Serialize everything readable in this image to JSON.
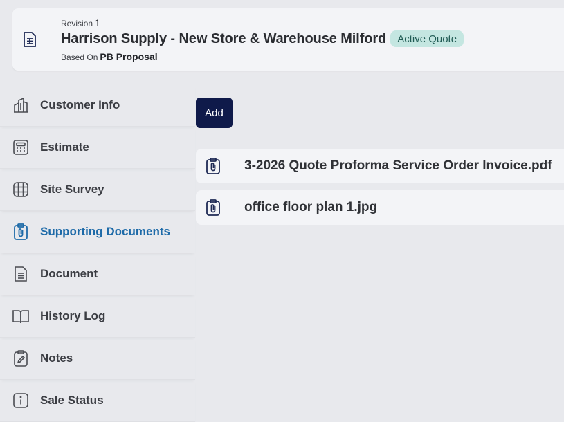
{
  "header": {
    "revision_label": "Revision",
    "revision_number": "1",
    "title": "Harrison Supply - New Store & Warehouse Milford",
    "status_badge": "Active Quote",
    "based_on_label": "Based On",
    "based_on_value": "PB Proposal"
  },
  "sidebar": {
    "items": [
      {
        "label": "Customer Info",
        "icon": "building-icon"
      },
      {
        "label": "Estimate",
        "icon": "calculator-icon"
      },
      {
        "label": "Site Survey",
        "icon": "grid-globe-icon"
      },
      {
        "label": "Supporting Documents",
        "icon": "clipboard-paperclip-icon",
        "active": true
      },
      {
        "label": "Document",
        "icon": "document-icon"
      },
      {
        "label": "History Log",
        "icon": "book-icon"
      },
      {
        "label": "Notes",
        "icon": "clipboard-pencil-icon"
      },
      {
        "label": "Sale Status",
        "icon": "info-icon"
      }
    ]
  },
  "main": {
    "add_label": "Add",
    "documents": [
      {
        "name": "3-2026 Quote Proforma Service Order Invoice.pdf"
      },
      {
        "name": "office floor plan 1.jpg"
      }
    ]
  },
  "colors": {
    "active": "#1d6aa8",
    "add_button": "#0f1a4a",
    "badge_bg": "#c4e6e1",
    "badge_text": "#1f5a53"
  }
}
